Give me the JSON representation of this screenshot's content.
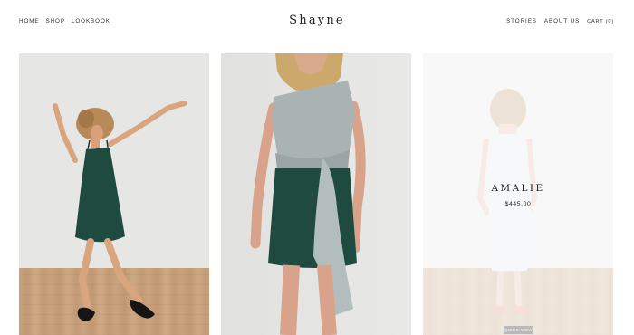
{
  "nav_left": [
    {
      "label": "HOME"
    },
    {
      "label": "SHOP"
    },
    {
      "label": "LOOKBOOK"
    }
  ],
  "brand": {
    "name": "Shayne"
  },
  "nav_right": {
    "stories": "STORIES",
    "about": "ABOUT US",
    "cart": "CART (0)"
  },
  "products": [
    {
      "name": "",
      "price": "",
      "dress_color": "#1f4a40"
    },
    {
      "name": "",
      "price": "",
      "dress_color": "#1f4a40"
    },
    {
      "name": "AMALIE",
      "price": "$445.00",
      "quick_view_label": "QUICK VIEW",
      "dress_color": "#e3e6e8"
    }
  ]
}
